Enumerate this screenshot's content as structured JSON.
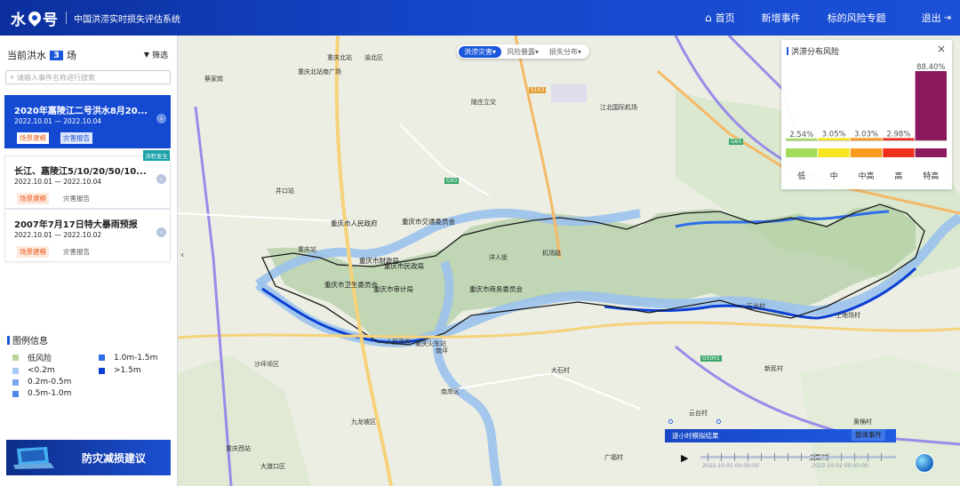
{
  "app": {
    "logo_left": "水",
    "logo_right": "号",
    "subtitle": "中国洪涝实时损失评估系统",
    "nav": [
      "首页",
      "新增事件",
      "标的风险专题"
    ],
    "logout": "退出"
  },
  "left": {
    "prefix": "当前洪水",
    "count": "3",
    "suffix": "场",
    "filter": "筛选",
    "search_placeholder": "请输入事件名称进行搜索",
    "events": [
      {
        "title": "2020年嘉陵江二号洪水8月20...",
        "date": "2022.10.01 — 2022.10.04",
        "tag1": "场景建模",
        "tag2": "灾害报告",
        "badge": ""
      },
      {
        "title": "长江、嘉陵江5/10/20/50/10...",
        "date": "2022.10.01 — 2022.10.04",
        "tag1": "场景建模",
        "tag2": "灾害报告",
        "badge": "洪积发生"
      },
      {
        "title": "2007年7月17日特大暴雨预报",
        "date": "2022.10.01 — 2022.10.02",
        "tag1": "场景建模",
        "tag2": "灾害报告",
        "badge": ""
      }
    ],
    "legend_title": "图例信息",
    "legend": [
      {
        "label": "低风险",
        "color": "#b9d49b"
      },
      {
        "label": "1.0m-1.5m",
        "color": "#2d6ee8"
      },
      {
        "label": "<0.2m",
        "color": "#a9c8f3"
      },
      {
        "label": ">1.5m",
        "color": "#0b3fd4"
      },
      {
        "label": "0.2m-0.5m",
        "color": "#7aa7ef"
      },
      {
        "label": "",
        "color": ""
      },
      {
        "label": "0.5m-1.0m",
        "color": "#4f88ea"
      },
      {
        "label": "",
        "color": ""
      }
    ],
    "advice": "防灾减损建议"
  },
  "map": {
    "tabs": [
      "洪涝灾害▾",
      "风险暴露▾",
      "损失分布▾"
    ],
    "places": [
      {
        "t": "重庆北站"
      },
      {
        "t": "江北国际机场"
      },
      {
        "t": "重庆北站南广场"
      },
      {
        "t": "蔡家岗"
      },
      {
        "t": "陵庄立交"
      },
      {
        "t": "重庆市人民政府"
      },
      {
        "t": "重庆市财政局"
      },
      {
        "t": "重庆市民政局"
      },
      {
        "t": "重庆市交通委员会"
      },
      {
        "t": "重庆市卫生委员会"
      },
      {
        "t": "重庆市审计局"
      },
      {
        "t": "重庆市商务委员会"
      },
      {
        "t": "重庆站"
      },
      {
        "t": "洋人街"
      },
      {
        "t": "南坪"
      },
      {
        "t": "机场路"
      },
      {
        "t": "人民政府"
      },
      {
        "t": "大渡口区"
      },
      {
        "t": "九龙坡区"
      },
      {
        "t": "南岸区"
      },
      {
        "t": "沙坪坝区"
      },
      {
        "t": "重庆西站"
      },
      {
        "t": "渝北区"
      },
      {
        "t": "井口站"
      },
      {
        "t": "土地场村"
      },
      {
        "t": "石龙村"
      },
      {
        "t": "广福村"
      },
      {
        "t": "大石村"
      },
      {
        "t": "黄桷村"
      },
      {
        "t": "云台村"
      },
      {
        "t": "新民村"
      },
      {
        "t": "金鳌村"
      },
      {
        "t": "重庆火车站"
      }
    ],
    "roads": [
      "G65",
      "S103",
      "G5001",
      "G93"
    ]
  },
  "risk": {
    "title": "洪涝分布风险",
    "close": "×",
    "chart_data": {
      "type": "bar",
      "title": "洪涝分布风险",
      "categories": [
        "低",
        "中",
        "中高",
        "高",
        "特高"
      ],
      "values": [
        2.54,
        3.05,
        3.03,
        2.98,
        88.4
      ],
      "labels": [
        "2.54%",
        "3.05%",
        "3.03%",
        "2.98%",
        "88.40%"
      ],
      "colors": [
        "#a3dc5a",
        "#f6e420",
        "#f89a1c",
        "#f0301c",
        "#8b1a5e"
      ],
      "ylim": [
        0,
        88.4
      ]
    }
  },
  "timeline": {
    "title": "逐小时模拟结果",
    "button": "整体事件",
    "start": "2022-10-01 00:00:00",
    "end": "2022-10-02 00:00:00"
  }
}
